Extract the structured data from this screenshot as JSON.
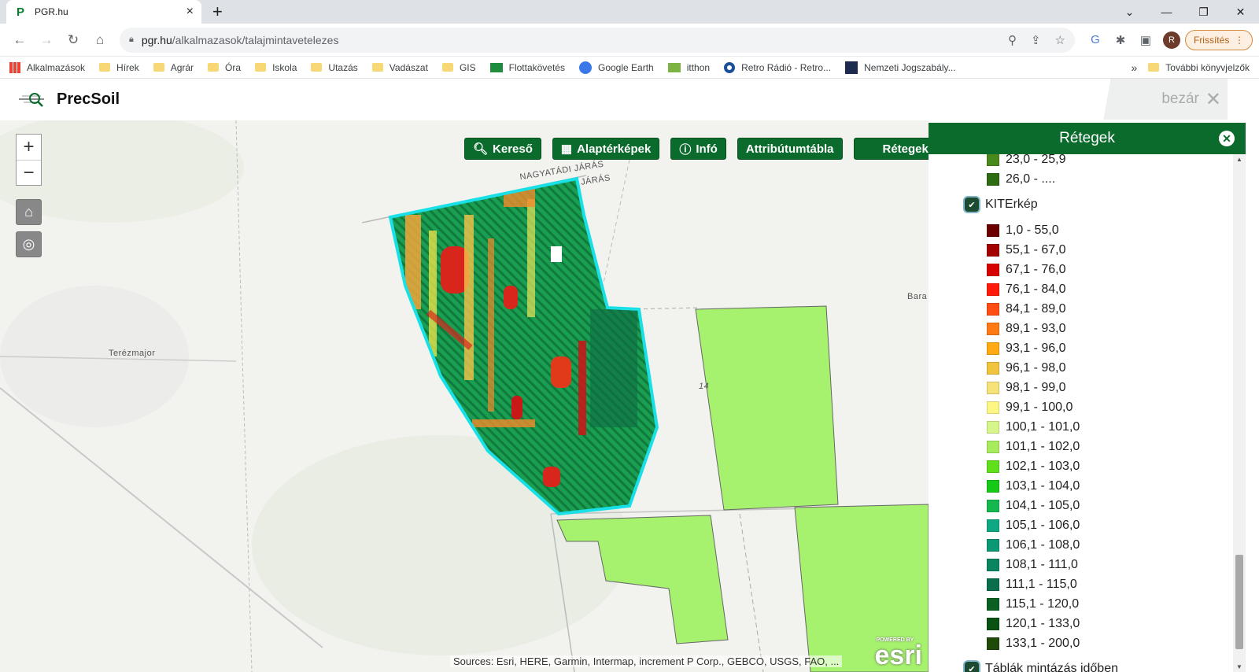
{
  "browser": {
    "tab_title": "PGR.hu",
    "tab_close": "×",
    "new_tab": "+",
    "url_host": "pgr.hu",
    "url_path": "/alkalmazasok/talajmintavetelezes",
    "avatar_letter": "R",
    "update_label": "Frissítés",
    "bookmarks": [
      "Alkalmazások",
      "Hírek",
      "Agrár",
      "Óra",
      "Iskola",
      "Utazás",
      "Vadászat",
      "GIS",
      "Flottakövetés",
      "Google Earth",
      "itthon",
      "Retro Rádió - Retro...",
      "Nemzeti Jogszabály..."
    ],
    "more_bookmarks": "»",
    "other_bookmarks": "További könyvjelzők"
  },
  "app": {
    "title": "PrecSoil",
    "close_label": "bezár"
  },
  "map": {
    "zoom_in": "+",
    "zoom_out": "−",
    "buttons": {
      "search": "Kereső",
      "basemaps": "Alaptérképek",
      "info": "Infó",
      "attribute_table": "Attribútumtábla",
      "layers": "Rétegek"
    },
    "labels": {
      "road1": "NAGYATÁDI JÁRÁS",
      "road2": "JÁRÁS",
      "terezmajor": "Terézmajor",
      "bara": "Bara",
      "num": "14"
    },
    "attribution": "Sources: Esri, HERE, Garmin, Intermap, increment P Corp., GEBCO, USGS, FAO, ...",
    "esri_powered": "POWERED BY",
    "esri_logo": "esri"
  },
  "panel": {
    "title": "Rétegek",
    "prev_legend": [
      {
        "label": "23,0 - 25,9",
        "color": "#4a8a1c"
      },
      {
        "label": "26,0 - ....",
        "color": "#2e6b12"
      }
    ],
    "layer_name": "KITErkép",
    "legend": [
      {
        "label": "1,0 - 55,0",
        "color": "#6b0000"
      },
      {
        "label": "55,1 - 67,0",
        "color": "#a30000"
      },
      {
        "label": "67,1 - 76,0",
        "color": "#d60000"
      },
      {
        "label": "76,1 - 84,0",
        "color": "#ff1a0a"
      },
      {
        "label": "84,1 - 89,0",
        "color": "#ff4d14"
      },
      {
        "label": "89,1 - 93,0",
        "color": "#ff7a14"
      },
      {
        "label": "93,1 - 96,0",
        "color": "#ffaa14"
      },
      {
        "label": "96,1 - 98,0",
        "color": "#f0c43c"
      },
      {
        "label": "98,1 - 99,0",
        "color": "#f7e27a"
      },
      {
        "label": "99,1 - 100,0",
        "color": "#fff785"
      },
      {
        "label": "100,1 - 101,0",
        "color": "#d6f58a"
      },
      {
        "label": "101,1 - 102,0",
        "color": "#a6ec5c"
      },
      {
        "label": "102,1 - 103,0",
        "color": "#5fe01a"
      },
      {
        "label": "103,1 - 104,0",
        "color": "#16c916"
      },
      {
        "label": "104,1 - 105,0",
        "color": "#14b84f"
      },
      {
        "label": "105,1 - 106,0",
        "color": "#0ea882"
      },
      {
        "label": "106,1 - 108,0",
        "color": "#0d9874"
      },
      {
        "label": "108,1 - 111,0",
        "color": "#0b8460"
      },
      {
        "label": "111,1 - 115,0",
        "color": "#0a6e4c"
      },
      {
        "label": "115,1 - 120,0",
        "color": "#0a5f22"
      },
      {
        "label": "120,1 - 133,0",
        "color": "#0a5212"
      },
      {
        "label": "133,1 - 200,0",
        "color": "#1f4a0a"
      }
    ],
    "next_layer": "Táblák mintázás időben"
  }
}
